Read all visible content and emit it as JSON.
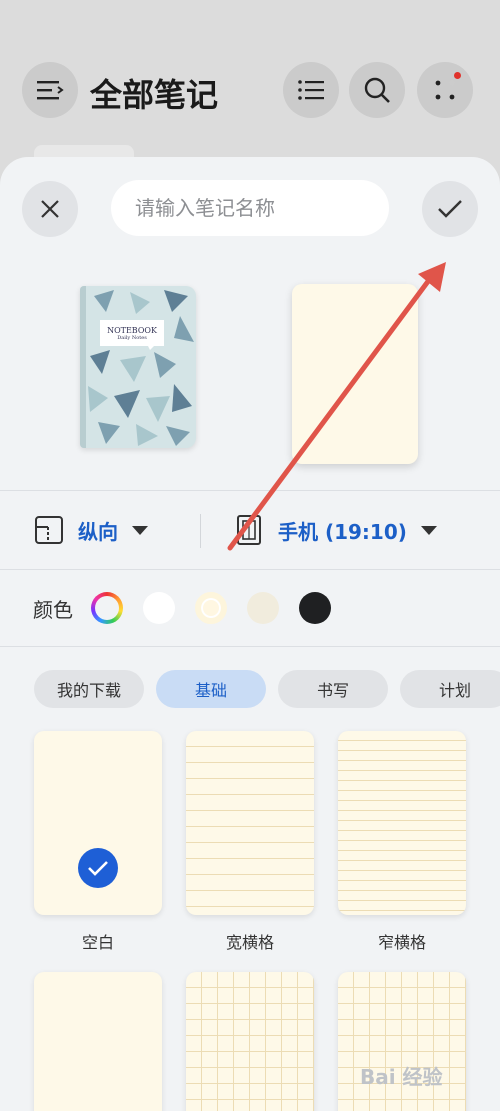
{
  "header": {
    "title": "全部笔记",
    "icons": [
      "menu-icon",
      "list-icon",
      "search-icon",
      "more-icon"
    ],
    "notification_dot_color": "#e0322b"
  },
  "sheet": {
    "name_placeholder": "请输入笔记名称",
    "close_icon": "close-icon",
    "confirm_icon": "check-icon",
    "cover": {
      "title": "NOTEBOOK",
      "subtitle": "Daily Notes"
    },
    "orientation": {
      "label": "纵向",
      "icon": "page-orientation-icon"
    },
    "size": {
      "label": "手机 (19:10)",
      "icon": "phone-size-icon"
    },
    "color": {
      "label": "颜色",
      "swatches": [
        "#ffffff",
        "#fff7e2",
        "#f1ecdd",
        "#1f2022"
      ]
    },
    "tabs": [
      {
        "label": "我的下载",
        "active": false
      },
      {
        "label": "基础",
        "active": true
      },
      {
        "label": "书写",
        "active": false
      },
      {
        "label": "计划",
        "active": false
      }
    ],
    "templates": [
      {
        "label": "空白",
        "selected": true
      },
      {
        "label": "宽横格",
        "selected": false
      },
      {
        "label": "窄横格",
        "selected": false
      },
      {
        "label": "",
        "selected": false
      },
      {
        "label": "",
        "selected": false
      },
      {
        "label": "",
        "selected": false
      }
    ]
  },
  "accent_color": "#1c5fc7",
  "annotation_arrow_color": "#e0554a",
  "watermark": "Bai 经验"
}
